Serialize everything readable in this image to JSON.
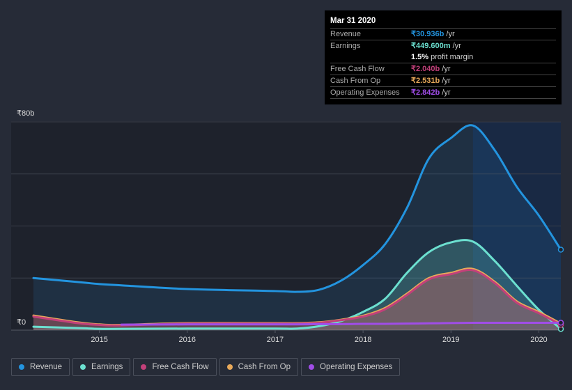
{
  "tooltip": {
    "date": "Mar 31 2020",
    "rows": [
      {
        "label": "Revenue",
        "value": "₹30.936b",
        "unit": " /yr",
        "color": "#2394df"
      },
      {
        "label": "Earnings",
        "value": "₹449.600m",
        "unit": " /yr",
        "color": "#6ce0d0"
      },
      {
        "label": "",
        "value": "1.5%",
        "unit": " profit margin",
        "color": "#ffffff"
      },
      {
        "label": "Free Cash Flow",
        "value": "₹2.040b",
        "unit": " /yr",
        "color": "#c2407a"
      },
      {
        "label": "Cash From Op",
        "value": "₹2.531b",
        "unit": " /yr",
        "color": "#e8a95a"
      },
      {
        "label": "Operating Expenses",
        "value": "₹2.842b",
        "unit": " /yr",
        "color": "#a04de8"
      }
    ]
  },
  "chart_data": {
    "type": "area",
    "ylim": [
      0,
      80
    ],
    "xlim": [
      2014.25,
      2020.25
    ],
    "y_tick_labels": [
      "₹0",
      "₹80b"
    ],
    "x_tick_labels": [
      "2015",
      "2016",
      "2017",
      "2018",
      "2019",
      "2020"
    ],
    "x_ticks": [
      2015,
      2016,
      2017,
      2018,
      2019,
      2020
    ],
    "grid": true,
    "highlight_range": [
      2019.25,
      2020.25
    ],
    "legend_position": "bottom",
    "x": [
      2014.25,
      2014.75,
      2015,
      2015.25,
      2016,
      2017,
      2017.25,
      2017.5,
      2017.75,
      2018,
      2018.25,
      2018.5,
      2018.75,
      2019,
      2019.25,
      2019.5,
      2019.75,
      2020,
      2020.25
    ],
    "series": [
      {
        "name": "Revenue",
        "color": "#2394df",
        "values": [
          20,
          18.5,
          17.7,
          17.2,
          15.8,
          15,
          14.7,
          15.5,
          19,
          25,
          33,
          47,
          66,
          73.8,
          78.6,
          69,
          55,
          44,
          30.9
        ]
      },
      {
        "name": "Earnings",
        "color": "#6ce0d0",
        "values": [
          1.3,
          0.8,
          0.5,
          0.5,
          0.6,
          0.6,
          0.6,
          1.5,
          3.5,
          7,
          12,
          22,
          30,
          33.7,
          34,
          26.5,
          17,
          7.8,
          0.45
        ]
      },
      {
        "name": "Free Cash Flow",
        "color": "#c2407a",
        "values": [
          5.2,
          2.7,
          2,
          1.8,
          2.5,
          2.5,
          2.5,
          2.8,
          3.8,
          5.2,
          8,
          13.5,
          19.5,
          21.5,
          23,
          18,
          10.5,
          6.5,
          2.04
        ]
      },
      {
        "name": "Cash From Op",
        "color": "#e8a95a",
        "values": [
          5.6,
          3,
          2.2,
          2,
          2.7,
          2.7,
          2.7,
          3,
          4,
          5.5,
          8.5,
          14,
          20,
          22,
          23.5,
          18.5,
          11,
          7,
          2.53
        ]
      },
      {
        "name": "Operating Expenses",
        "color": "#a04de8",
        "values": [
          null,
          null,
          null,
          2.1,
          2.2,
          2.2,
          2.2,
          2.3,
          2.3,
          2.4,
          2.4,
          2.5,
          2.6,
          2.7,
          2.8,
          2.8,
          2.8,
          2.8,
          2.84
        ]
      }
    ]
  }
}
